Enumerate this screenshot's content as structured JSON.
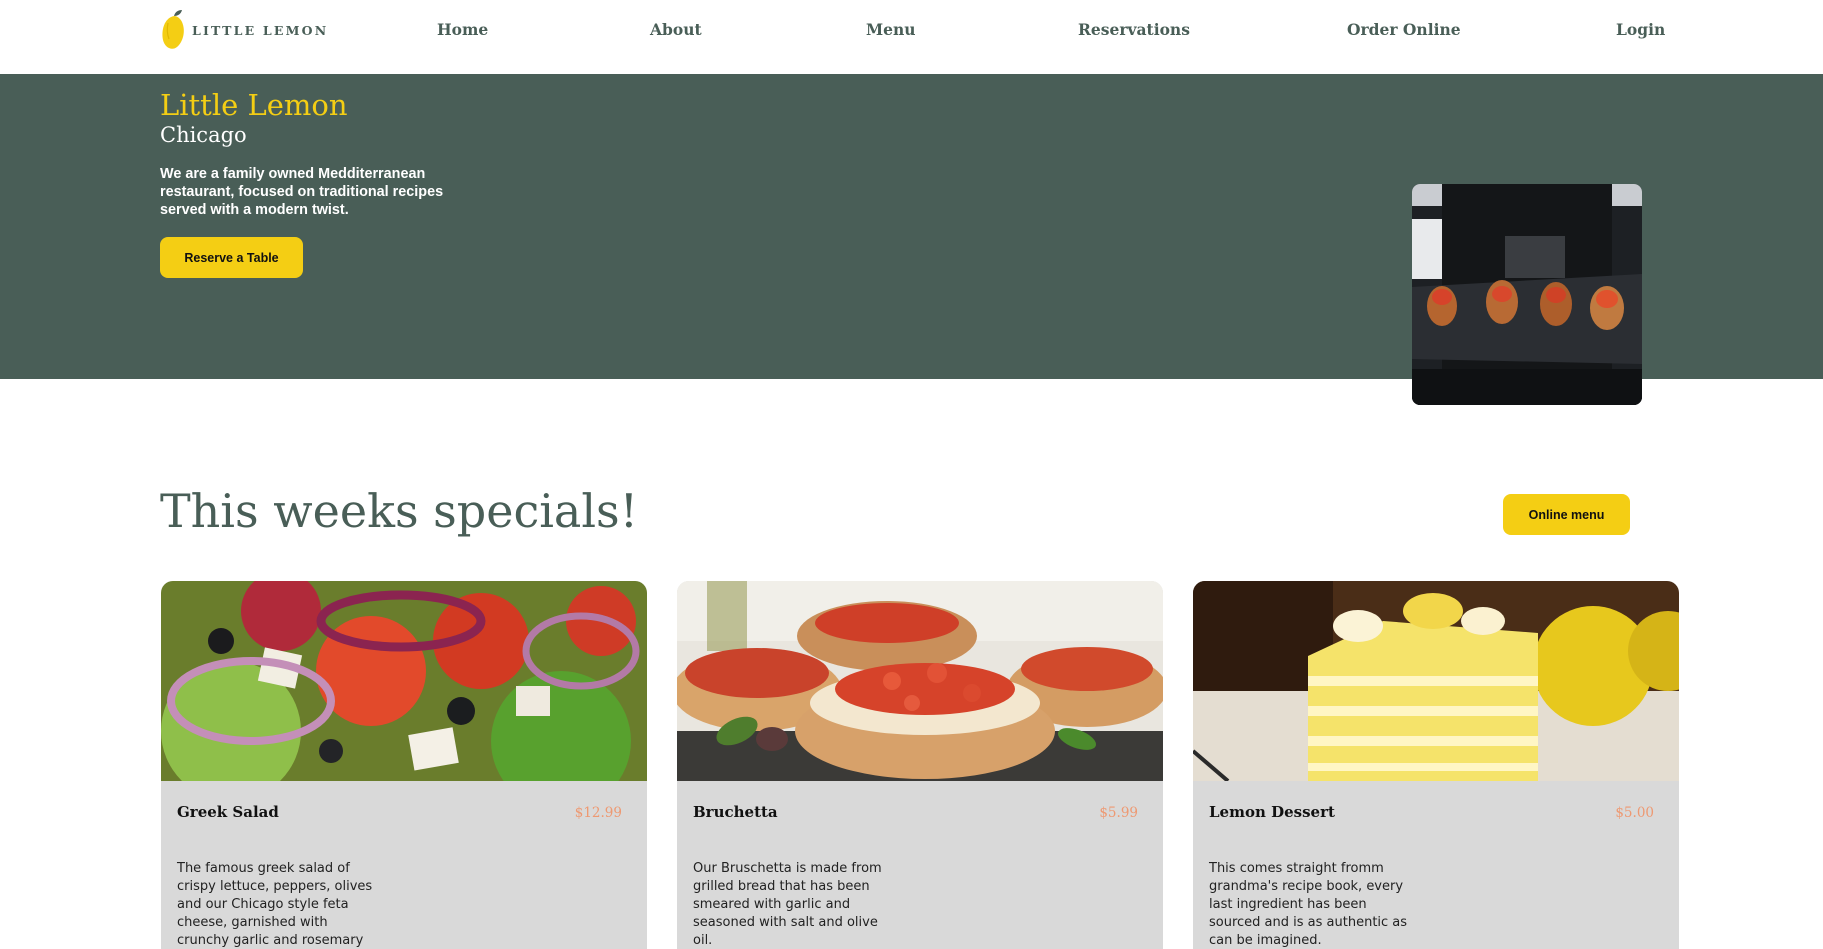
{
  "brand": {
    "logo_text": "LITTLE LEMON"
  },
  "nav": {
    "items": [
      {
        "label": "Home"
      },
      {
        "label": "About"
      },
      {
        "label": "Menu"
      },
      {
        "label": "Reservations"
      },
      {
        "label": "Order Online"
      },
      {
        "label": "Login"
      }
    ]
  },
  "hero": {
    "title": "Little Lemon",
    "subtitle": "Chicago",
    "description": "We are a family owned Medditerranean restaurant, focused on traditional recipes served with a modern twist.",
    "cta_label": "Reserve a Table"
  },
  "specials": {
    "title": "This weeks specials!",
    "menu_button_label": "Online menu",
    "cards": [
      {
        "name": "Greek Salad",
        "price": "$12.99",
        "description": "The famous greek salad of crispy lettuce, peppers, olives and our Chicago style feta cheese, garnished with crunchy garlic and rosemary"
      },
      {
        "name": "Bruchetta",
        "price": "$5.99",
        "description": "Our Bruschetta is made from grilled bread that has been smeared with garlic and seasoned with salt and olive oil."
      },
      {
        "name": "Lemon Dessert",
        "price": "$5.00",
        "description": "This comes straight fromm grandma's recipe book, every last ingredient has been sourced and is as authentic as can be imagined."
      }
    ]
  },
  "colors": {
    "primary_green": "#495e57",
    "primary_yellow": "#f4ce14",
    "price_salmon": "#ee9972",
    "card_gray": "#d9d9d9"
  }
}
